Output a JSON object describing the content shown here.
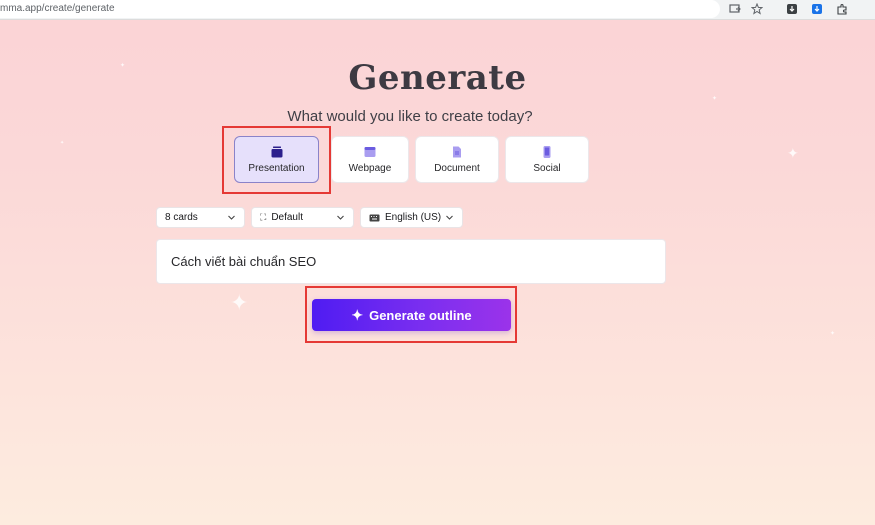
{
  "browser": {
    "url": "mma.app/create/generate",
    "icons": [
      "install-app-icon",
      "bookmark-star-icon",
      "extension-download-icon",
      "extension-download-blue-icon",
      "extensions-puzzle-icon"
    ]
  },
  "page": {
    "title": "Generate",
    "subtitle": "What would you like to create today?"
  },
  "content_types": [
    {
      "label": "Presentation",
      "icon": "presentation-icon",
      "selected": true
    },
    {
      "label": "Webpage",
      "icon": "webpage-icon",
      "selected": false
    },
    {
      "label": "Document",
      "icon": "document-icon",
      "selected": false
    },
    {
      "label": "Social",
      "icon": "social-icon",
      "selected": false
    }
  ],
  "options": {
    "cards": {
      "value": "8 cards"
    },
    "theme": {
      "value": "Default",
      "icon": "aspect-ratio-icon"
    },
    "language": {
      "value": "English (US)",
      "icon": "keyboard-icon"
    }
  },
  "prompt": {
    "value": "Cách viết bài chuẩn SEO"
  },
  "generate_button": {
    "label": "Generate outline",
    "icon": "sparkle-icon"
  },
  "colors": {
    "accent_start": "#4f1cf2",
    "accent_end": "#9b33ea",
    "selected_card_bg": "#e6e0fb",
    "highlight_box": "#e53935"
  }
}
